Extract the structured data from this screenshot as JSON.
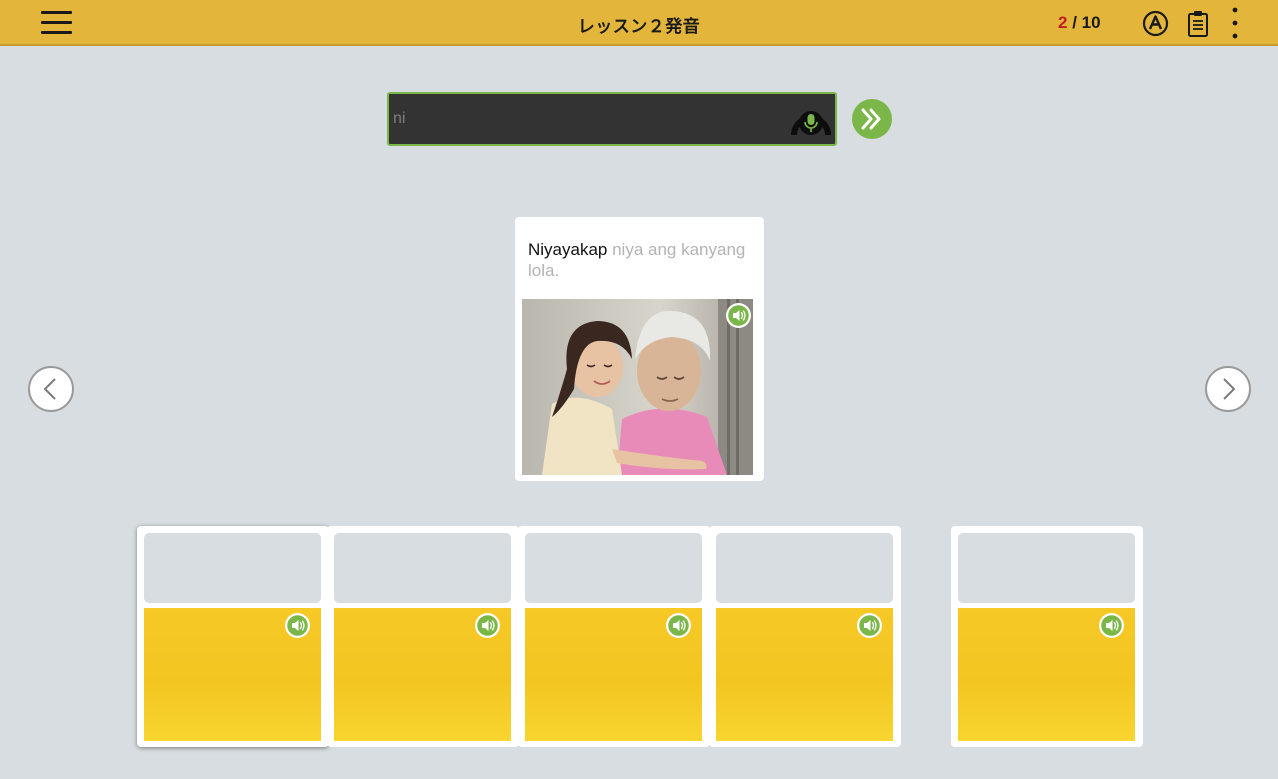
{
  "header": {
    "title": "レッスン２発音",
    "progress_current": "2",
    "progress_separator": " / ",
    "progress_total": "10",
    "icons": [
      "menu-icon",
      "auto-a-icon",
      "clipboard-icon",
      "more-vertical-icon"
    ]
  },
  "speech": {
    "input_value": "ni",
    "mic_icon": "microphone-icon",
    "next_icon": "double-chevron-right-icon"
  },
  "prompt": {
    "highlighted": "Niyayakap",
    "rest": " niya ang kanyang lola.",
    "photo_icon": "speaker-icon"
  },
  "nav": {
    "prev_icon": "chevron-left-icon",
    "next_icon": "chevron-right-icon"
  },
  "choices": [
    {
      "selected": true,
      "icon": "speaker-icon"
    },
    {
      "selected": false,
      "icon": "speaker-icon"
    },
    {
      "selected": false,
      "icon": "speaker-icon"
    },
    {
      "selected": false,
      "icon": "speaker-icon"
    },
    {
      "selected": false,
      "icon": "speaker-icon"
    }
  ],
  "colors": {
    "header": "#e3b53a",
    "background": "#d7dde0",
    "accent_green": "#7ab648",
    "progress_current": "#c0201f",
    "card_yellow": "#f6c927",
    "input_dark": "#333333"
  }
}
